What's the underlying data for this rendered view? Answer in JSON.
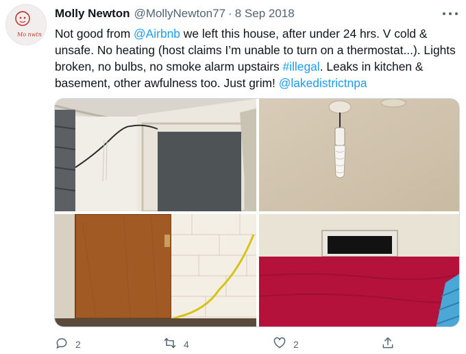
{
  "tweet": {
    "display_name": "Molly Newton",
    "handle": "@MollyNewton77",
    "separator": "·",
    "date": "8 Sep 2018",
    "avatar_text": "Mo nwtn",
    "text_segments": {
      "s1": "Not good from ",
      "m1": "@Airbnb",
      "s2": " we left this house, after under 24 hrs. V cold & unsafe. No heating (host claims I’m unable to turn on a thermostat...). Lights broken, no bulbs, no smoke alarm upstairs ",
      "h1": "#illegal",
      "s3": ". Leaks in kitchen & basement, other awfulness too. Just grim! ",
      "m2": "@lakedistrictnpa"
    },
    "photos": [
      "ceiling-corner-photo",
      "ceiling-lightbulb-photo",
      "door-and-wall-photo",
      "bed-and-vent-photo"
    ],
    "actions": {
      "reply_count": "2",
      "retweet_count": "4",
      "like_count": "2"
    },
    "colors": {
      "link": "#1d9bf0",
      "secondary_text": "#536471",
      "primary_text": "#0f1419"
    }
  }
}
